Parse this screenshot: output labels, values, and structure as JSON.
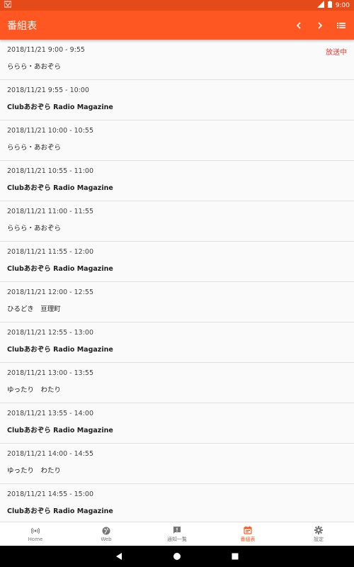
{
  "status_bar": {
    "carrier_icon": "data-icon",
    "signal": "LTE-signal-icon",
    "battery": "battery-icon",
    "time": "9:00"
  },
  "app_bar": {
    "title": "番組表",
    "prev_icon": "chevron-left-icon",
    "next_icon": "chevron-right-icon",
    "list_icon": "list-icon"
  },
  "schedule": [
    {
      "time": "2018/11/21 9:00 - 9:55",
      "title": "ららら・あおぞら",
      "status": "放送中"
    },
    {
      "time": "2018/11/21 9:55 - 10:00",
      "title": "Clubあおぞら Radio Magazine",
      "status": ""
    },
    {
      "time": "2018/11/21 10:00 - 10:55",
      "title": "ららら・あおぞら",
      "status": ""
    },
    {
      "time": "2018/11/21 10:55 - 11:00",
      "title": "Clubあおぞら Radio Magazine",
      "status": ""
    },
    {
      "time": "2018/11/21 11:00 - 11:55",
      "title": "ららら・あおぞら",
      "status": ""
    },
    {
      "time": "2018/11/21 11:55 - 12:00",
      "title": "Clubあおぞら Radio Magazine",
      "status": ""
    },
    {
      "time": "2018/11/21 12:00 - 12:55",
      "title": "ひるどき　亘理町",
      "status": ""
    },
    {
      "time": "2018/11/21 12:55 - 13:00",
      "title": "Clubあおぞら Radio Magazine",
      "status": ""
    },
    {
      "time": "2018/11/21 13:00 - 13:55",
      "title": "ゆったり　わたり",
      "status": ""
    },
    {
      "time": "2018/11/21 13:55 - 14:00",
      "title": "Clubあおぞら Radio Magazine",
      "status": ""
    },
    {
      "time": "2018/11/21 14:00 - 14:55",
      "title": "ゆったり　わたり",
      "status": ""
    },
    {
      "time": "2018/11/21 14:55 - 15:00",
      "title": "Clubあおぞら Radio Magazine",
      "status": ""
    }
  ],
  "bottom_nav": [
    {
      "label": "Home",
      "icon": "radio-tower-icon",
      "active": false
    },
    {
      "label": "Web",
      "icon": "globe-icon",
      "active": false
    },
    {
      "label": "通知一覧",
      "icon": "feedback-icon",
      "active": false
    },
    {
      "label": "番組表",
      "icon": "calendar-icon",
      "active": true
    },
    {
      "label": "設定",
      "icon": "gear-icon",
      "active": false
    }
  ],
  "colors": {
    "primary": "#ff5722",
    "status_bar": "#e64a19",
    "on_air": "#e53935"
  }
}
